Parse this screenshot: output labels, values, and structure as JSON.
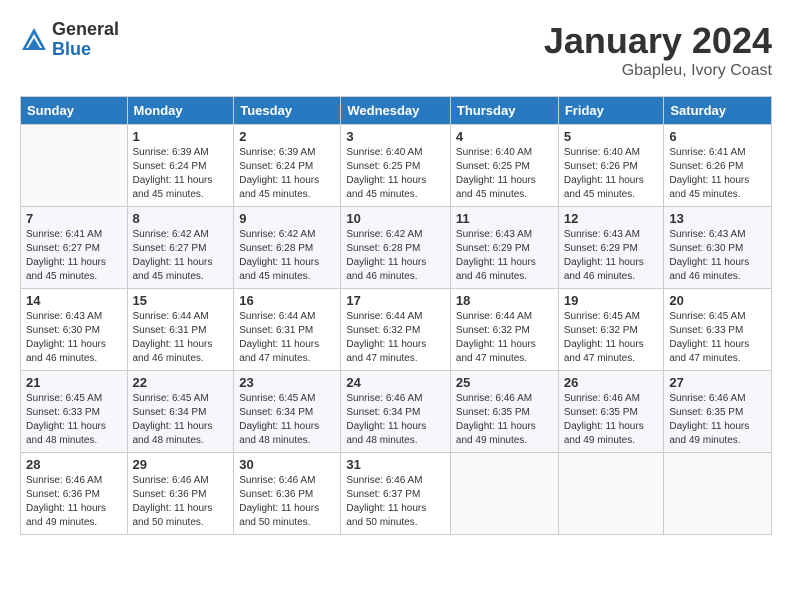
{
  "logo": {
    "general": "General",
    "blue": "Blue"
  },
  "title": "January 2024",
  "subtitle": "Gbapleu, Ivory Coast",
  "weekdays": [
    "Sunday",
    "Monday",
    "Tuesday",
    "Wednesday",
    "Thursday",
    "Friday",
    "Saturday"
  ],
  "weeks": [
    [
      {
        "day": "",
        "info": ""
      },
      {
        "day": "1",
        "info": "Sunrise: 6:39 AM\nSunset: 6:24 PM\nDaylight: 11 hours\nand 45 minutes."
      },
      {
        "day": "2",
        "info": "Sunrise: 6:39 AM\nSunset: 6:24 PM\nDaylight: 11 hours\nand 45 minutes."
      },
      {
        "day": "3",
        "info": "Sunrise: 6:40 AM\nSunset: 6:25 PM\nDaylight: 11 hours\nand 45 minutes."
      },
      {
        "day": "4",
        "info": "Sunrise: 6:40 AM\nSunset: 6:25 PM\nDaylight: 11 hours\nand 45 minutes."
      },
      {
        "day": "5",
        "info": "Sunrise: 6:40 AM\nSunset: 6:26 PM\nDaylight: 11 hours\nand 45 minutes."
      },
      {
        "day": "6",
        "info": "Sunrise: 6:41 AM\nSunset: 6:26 PM\nDaylight: 11 hours\nand 45 minutes."
      }
    ],
    [
      {
        "day": "7",
        "info": "Sunrise: 6:41 AM\nSunset: 6:27 PM\nDaylight: 11 hours\nand 45 minutes."
      },
      {
        "day": "8",
        "info": "Sunrise: 6:42 AM\nSunset: 6:27 PM\nDaylight: 11 hours\nand 45 minutes."
      },
      {
        "day": "9",
        "info": "Sunrise: 6:42 AM\nSunset: 6:28 PM\nDaylight: 11 hours\nand 45 minutes."
      },
      {
        "day": "10",
        "info": "Sunrise: 6:42 AM\nSunset: 6:28 PM\nDaylight: 11 hours\nand 46 minutes."
      },
      {
        "day": "11",
        "info": "Sunrise: 6:43 AM\nSunset: 6:29 PM\nDaylight: 11 hours\nand 46 minutes."
      },
      {
        "day": "12",
        "info": "Sunrise: 6:43 AM\nSunset: 6:29 PM\nDaylight: 11 hours\nand 46 minutes."
      },
      {
        "day": "13",
        "info": "Sunrise: 6:43 AM\nSunset: 6:30 PM\nDaylight: 11 hours\nand 46 minutes."
      }
    ],
    [
      {
        "day": "14",
        "info": "Sunrise: 6:43 AM\nSunset: 6:30 PM\nDaylight: 11 hours\nand 46 minutes."
      },
      {
        "day": "15",
        "info": "Sunrise: 6:44 AM\nSunset: 6:31 PM\nDaylight: 11 hours\nand 46 minutes."
      },
      {
        "day": "16",
        "info": "Sunrise: 6:44 AM\nSunset: 6:31 PM\nDaylight: 11 hours\nand 47 minutes."
      },
      {
        "day": "17",
        "info": "Sunrise: 6:44 AM\nSunset: 6:32 PM\nDaylight: 11 hours\nand 47 minutes."
      },
      {
        "day": "18",
        "info": "Sunrise: 6:44 AM\nSunset: 6:32 PM\nDaylight: 11 hours\nand 47 minutes."
      },
      {
        "day": "19",
        "info": "Sunrise: 6:45 AM\nSunset: 6:32 PM\nDaylight: 11 hours\nand 47 minutes."
      },
      {
        "day": "20",
        "info": "Sunrise: 6:45 AM\nSunset: 6:33 PM\nDaylight: 11 hours\nand 47 minutes."
      }
    ],
    [
      {
        "day": "21",
        "info": "Sunrise: 6:45 AM\nSunset: 6:33 PM\nDaylight: 11 hours\nand 48 minutes."
      },
      {
        "day": "22",
        "info": "Sunrise: 6:45 AM\nSunset: 6:34 PM\nDaylight: 11 hours\nand 48 minutes."
      },
      {
        "day": "23",
        "info": "Sunrise: 6:45 AM\nSunset: 6:34 PM\nDaylight: 11 hours\nand 48 minutes."
      },
      {
        "day": "24",
        "info": "Sunrise: 6:46 AM\nSunset: 6:34 PM\nDaylight: 11 hours\nand 48 minutes."
      },
      {
        "day": "25",
        "info": "Sunrise: 6:46 AM\nSunset: 6:35 PM\nDaylight: 11 hours\nand 49 minutes."
      },
      {
        "day": "26",
        "info": "Sunrise: 6:46 AM\nSunset: 6:35 PM\nDaylight: 11 hours\nand 49 minutes."
      },
      {
        "day": "27",
        "info": "Sunrise: 6:46 AM\nSunset: 6:35 PM\nDaylight: 11 hours\nand 49 minutes."
      }
    ],
    [
      {
        "day": "28",
        "info": "Sunrise: 6:46 AM\nSunset: 6:36 PM\nDaylight: 11 hours\nand 49 minutes."
      },
      {
        "day": "29",
        "info": "Sunrise: 6:46 AM\nSunset: 6:36 PM\nDaylight: 11 hours\nand 50 minutes."
      },
      {
        "day": "30",
        "info": "Sunrise: 6:46 AM\nSunset: 6:36 PM\nDaylight: 11 hours\nand 50 minutes."
      },
      {
        "day": "31",
        "info": "Sunrise: 6:46 AM\nSunset: 6:37 PM\nDaylight: 11 hours\nand 50 minutes."
      },
      {
        "day": "",
        "info": ""
      },
      {
        "day": "",
        "info": ""
      },
      {
        "day": "",
        "info": ""
      }
    ]
  ]
}
